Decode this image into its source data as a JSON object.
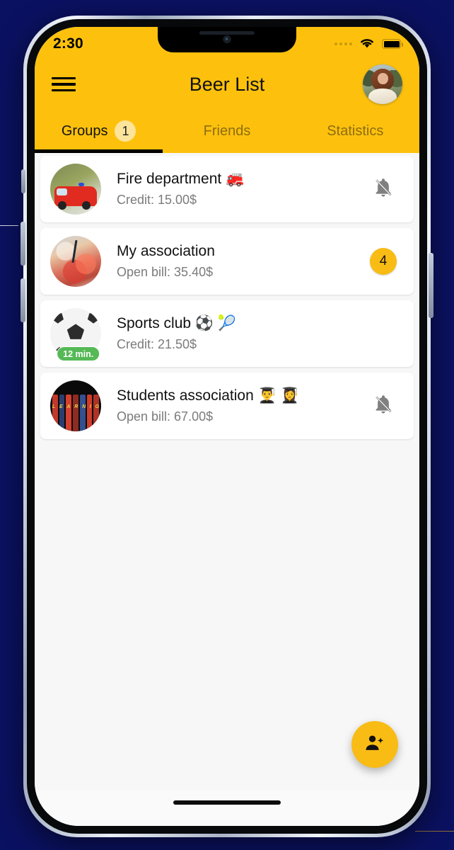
{
  "status_bar": {
    "time": "2:30",
    "signal_icon": "signal-dots-icon",
    "wifi_icon": "wifi-icon",
    "battery_icon": "battery-full-icon"
  },
  "app_bar": {
    "menu_icon": "hamburger-menu-icon",
    "title": "Beer List",
    "avatar_icon": "user-avatar-photo"
  },
  "tabs": [
    {
      "label": "Groups",
      "badge": "1",
      "active": true
    },
    {
      "label": "Friends",
      "badge": "",
      "active": false
    },
    {
      "label": "Statistics",
      "badge": "",
      "active": false
    }
  ],
  "groups": [
    {
      "title": "Fire department 🚒",
      "subtitle": "Credit: 15.00$",
      "avatar_icon": "fire-truck-photo",
      "trailing_type": "bell-off-icon",
      "trailing_value": "",
      "time_badge": ""
    },
    {
      "title": "My association",
      "subtitle": "Open bill: 35.40$",
      "avatar_icon": "drinks-cheers-photo",
      "trailing_type": "count-badge",
      "trailing_value": "4",
      "time_badge": ""
    },
    {
      "title": "Sports club ⚽ 🎾",
      "subtitle": "Credit: 21.50$",
      "avatar_icon": "soccer-ball-photo",
      "trailing_type": "none",
      "trailing_value": "",
      "time_badge": "12 min."
    },
    {
      "title": "Students association 👨‍🎓 👩‍🎓",
      "subtitle": "Open bill: 67.00$",
      "avatar_icon": "books-shelf-photo",
      "trailing_type": "bell-off-icon",
      "trailing_value": "",
      "time_badge": ""
    }
  ],
  "fab": {
    "icon": "person-add-icon",
    "label": ""
  },
  "colors": {
    "brand_yellow": "#FDC10D",
    "badge_yellow": "#F9BC15",
    "tab_badge_yellow": "#FDE49B",
    "green_badge": "#55B956",
    "backdrop_navy": "#0B1161",
    "card_white": "#FFFFFF",
    "content_bg": "#F7F7F7",
    "subtitle_gray": "#7B7B7B",
    "bell_gray": "#808080"
  }
}
